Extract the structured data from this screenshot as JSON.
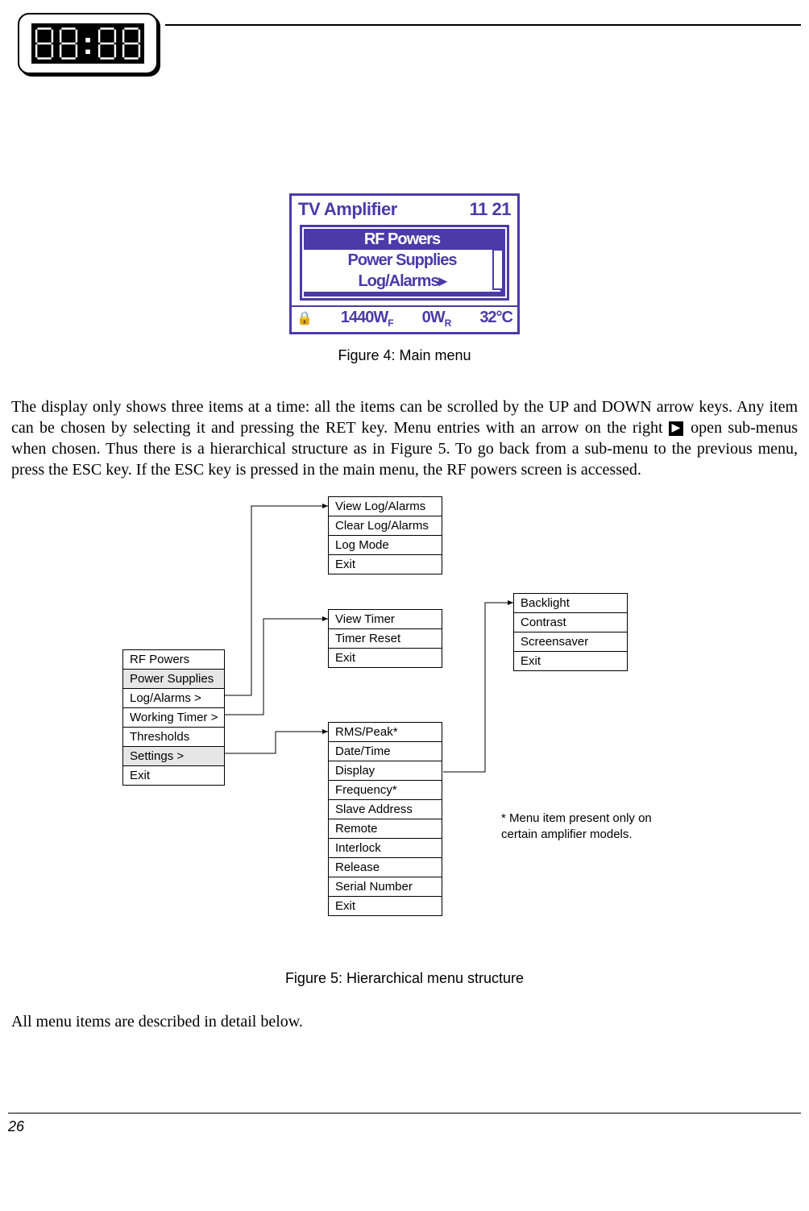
{
  "header": {
    "clock_display": "88:88"
  },
  "lcd": {
    "title": "TV Amplifier",
    "time": "11 21",
    "items": [
      "RF Powers",
      "Power Supplies",
      "Log/Alarms▸"
    ],
    "selected_index": 0,
    "footer": {
      "lock": "🔒",
      "wf": "1440W",
      "wf_sub": "F",
      "wr": "0W",
      "wr_sub": "R",
      "temp": "32°C"
    }
  },
  "captions": {
    "fig4": "Figure 4: Main menu",
    "fig5": "Figure 5: Hierarchical menu structure"
  },
  "paragraphs": {
    "p1a": "The display only shows three items at a time: all the items can be scrolled by the UP and DOWN arrow keys. Any item can be chosen by selecting it and pressing the RET key. Menu entries with an arrow on the right ",
    "p1b": " open sub-menus when chosen. Thus there is a hierarchical structure as in Figure 5. To go back from a sub-menu to the previous menu, press the ESC key. If the ESC key is pressed in the main menu, the RF powers screen is accessed.",
    "p2": "All menu items are described in detail below."
  },
  "hierarchy": {
    "main": [
      "RF Powers",
      "Power Supplies",
      "Log/Alarms >",
      "Working Timer >",
      "Thresholds",
      "Settings >",
      "Exit"
    ],
    "log": [
      "View Log/Alarms",
      "Clear Log/Alarms",
      "Log Mode",
      "Exit"
    ],
    "timer": [
      "View Timer",
      "Timer Reset",
      "Exit"
    ],
    "settings": [
      "RMS/Peak*",
      "Date/Time",
      "Display",
      "Frequency*",
      "Slave Address",
      "Remote",
      "Interlock",
      "Release",
      "Serial Number",
      "Exit"
    ],
    "display": [
      "Backlight",
      "Contrast",
      "Screensaver",
      "Exit"
    ],
    "note": "* Menu item present only on certain amplifier models."
  },
  "page_number": "26"
}
